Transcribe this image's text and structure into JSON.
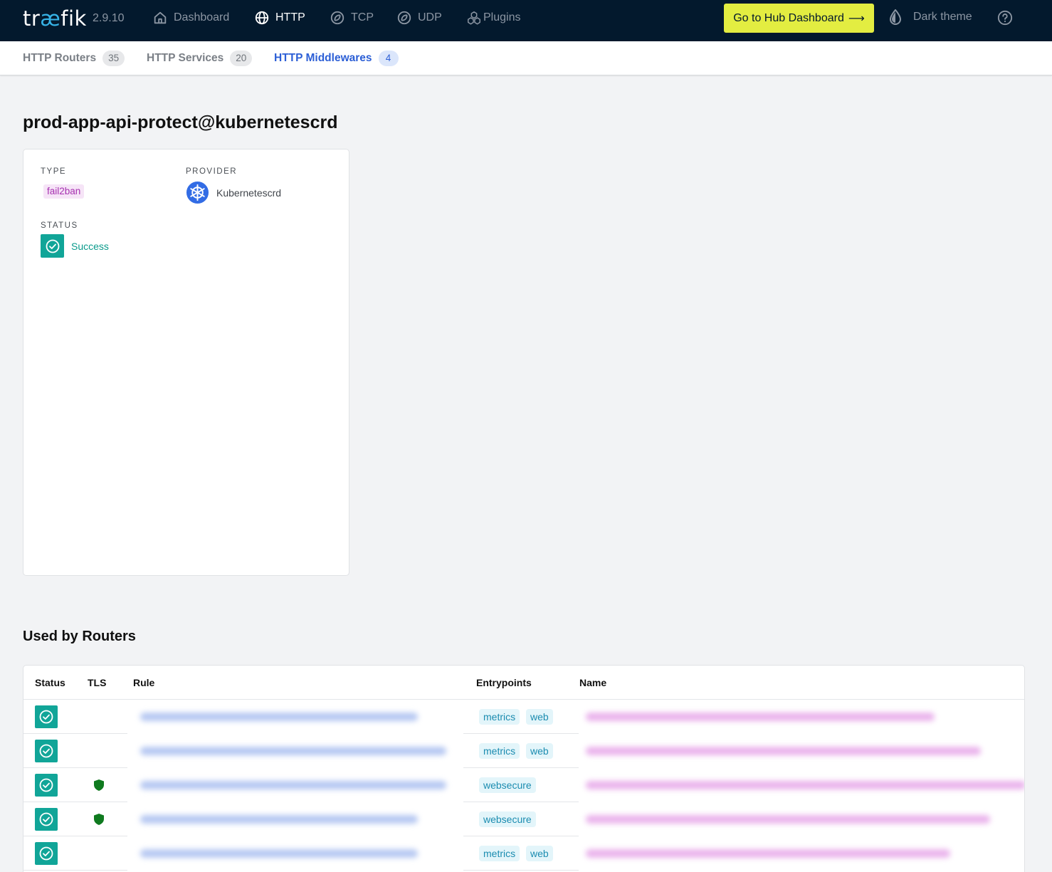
{
  "nav": {
    "logo_prefix": "tr",
    "logo_ae": "æ",
    "logo_suffix": "fik",
    "version": "2.9.10",
    "items": [
      {
        "label": "Dashboard",
        "icon": "home-icon"
      },
      {
        "label": "HTTP",
        "icon": "globe-icon"
      },
      {
        "label": "TCP",
        "icon": "tcp-icon"
      },
      {
        "label": "UDP",
        "icon": "udp-icon"
      },
      {
        "label": "Plugins",
        "icon": "plugins-icon"
      }
    ],
    "active": "HTTP",
    "hub_button": "Go to Hub Dashboard",
    "hub_arrow": "⟶",
    "theme_toggle": "Dark theme",
    "help_icon": "help-icon"
  },
  "subtabs": [
    {
      "label": "HTTP Routers",
      "count": "35"
    },
    {
      "label": "HTTP Services",
      "count": "20"
    },
    {
      "label": "HTTP Middlewares",
      "count": "4"
    }
  ],
  "active_subtab": "HTTP Middlewares",
  "middleware": {
    "title": "prod-app-api-protect@kubernetescrd",
    "type_label": "TYPE",
    "type_value": "fail2ban",
    "provider_label": "PROVIDER",
    "provider_value": "Kubernetescrd",
    "provider_icon": "kubernetes-icon",
    "status_label": "STATUS",
    "status_value": "Success"
  },
  "routers": {
    "title": "Used by Routers",
    "columns": [
      "Status",
      "TLS",
      "Rule",
      "Entrypoints",
      "Name"
    ],
    "rows": [
      {
        "status": "success",
        "tls": false,
        "entrypoints": [
          "metrics",
          "web"
        ]
      },
      {
        "status": "success",
        "tls": false,
        "entrypoints": [
          "metrics",
          "web"
        ]
      },
      {
        "status": "success",
        "tls": true,
        "entrypoints": [
          "websecure"
        ]
      },
      {
        "status": "success",
        "tls": true,
        "entrypoints": [
          "websecure"
        ]
      },
      {
        "status": "success",
        "tls": false,
        "entrypoints": [
          "metrics",
          "web"
        ]
      }
    ]
  },
  "colors": {
    "topbar": "#03192d",
    "hub_button": "#e3ed41",
    "accent_blue": "#2c5fd6",
    "success": "#11a598",
    "tls_shield": "#0f7a1f"
  }
}
